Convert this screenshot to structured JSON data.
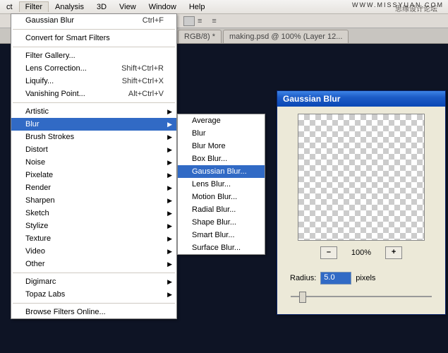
{
  "menubar": {
    "items": [
      "ct",
      "Filter",
      "Analysis",
      "3D",
      "View",
      "Window",
      "Help"
    ],
    "attribution": "思缘设计论坛"
  },
  "tabs": {
    "tab0": "RGB/8) *",
    "tab1": "making.psd @ 100% (Layer 12..."
  },
  "filter_menu": {
    "recent": "Gaussian Blur",
    "recent_shortcut": "Ctrl+F",
    "convert": "Convert for Smart Filters",
    "gallery": "Filter Gallery...",
    "lens": "Lens Correction...",
    "lens_sc": "Shift+Ctrl+R",
    "liquify": "Liquify...",
    "liquify_sc": "Shift+Ctrl+X",
    "vanish": "Vanishing Point...",
    "vanish_sc": "Alt+Ctrl+V",
    "cats": [
      "Artistic",
      "Blur",
      "Brush Strokes",
      "Distort",
      "Noise",
      "Pixelate",
      "Render",
      "Sharpen",
      "Sketch",
      "Stylize",
      "Texture",
      "Video",
      "Other"
    ],
    "digimarc": "Digimarc",
    "topaz": "Topaz Labs",
    "browse": "Browse Filters Online..."
  },
  "blur_submenu": [
    "Average",
    "Blur",
    "Blur More",
    "Box Blur...",
    "Gaussian Blur...",
    "Lens Blur...",
    "Motion Blur...",
    "Radial Blur...",
    "Shape Blur...",
    "Smart Blur...",
    "Surface Blur..."
  ],
  "dialog": {
    "title": "Gaussian Blur",
    "zoom_out": "–",
    "zoom_pct": "100%",
    "zoom_in": "+",
    "radius_label": "Radius:",
    "radius_value": "5.0",
    "radius_unit": "pixels"
  },
  "watermark": "WWW.MISSYUAN.COM"
}
